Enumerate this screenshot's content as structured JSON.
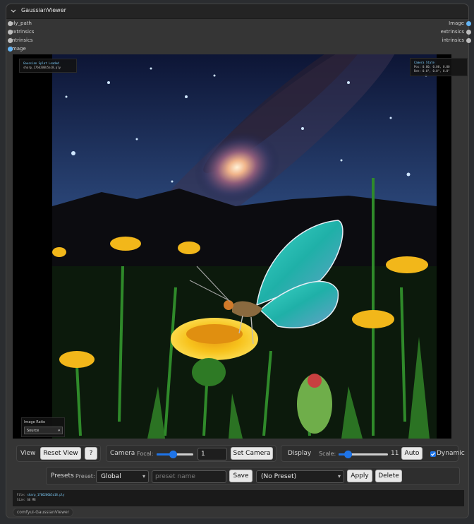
{
  "node": {
    "title": "GaussianViewer",
    "inputs": [
      {
        "label": "ply_path",
        "color": "#bdbdbd"
      },
      {
        "label": "extrinsics",
        "color": "#bdbdbd"
      },
      {
        "label": "intrinsics",
        "color": "#bdbdbd"
      },
      {
        "label": "image",
        "color": "#64b5f6"
      }
    ],
    "outputs": [
      {
        "label": "Image",
        "color": "#64b5f6"
      },
      {
        "label": "extrinsics",
        "color": "#bdbdbd"
      },
      {
        "label": "intrinsics",
        "color": "#bdbdbd"
      }
    ]
  },
  "viewer": {
    "load_title": "Gaussian Splat Loaded",
    "load_file": "sharp_1766206b5a18.ply",
    "camera_title": "Camera State",
    "camera_pos": "Pos: 0.00, 0.00, 0.00",
    "camera_rot": "Rot: 0.0°, 0.0°, 0.0°",
    "ratio_label": "Image Ratio",
    "ratio_value": "Source"
  },
  "controls": {
    "view_label": "View",
    "reset_view": "Reset View",
    "help": "?",
    "camera_label": "Camera",
    "focal_label": "Focal:",
    "focal_value": "1",
    "focal_level": 0.45,
    "set_camera": "Set Camera",
    "display_label": "Display",
    "scale_label": "Scale:",
    "scale_value": "11",
    "scale_level": 0.18,
    "auto": "Auto",
    "dynamic_label": "Dynamic",
    "dynamic_checked": true,
    "presets_label": "Presets",
    "preset_label": "Preset:",
    "preset_scope": "Global",
    "preset_name_placeholder": "preset name",
    "save": "Save",
    "preset_select": "(No Preset)",
    "apply": "Apply",
    "delete": "Delete"
  },
  "status": {
    "file_label": "File:",
    "file_value": "sharp_1766206b5a18.ply",
    "size_label": "Size:",
    "size_value": "66 MB"
  },
  "footer_tag": "comfyui-GaussianViewer",
  "colors": {
    "accent": "#1e74e8",
    "image_port": "#64b5f6",
    "default_port": "#bdbdbd"
  }
}
